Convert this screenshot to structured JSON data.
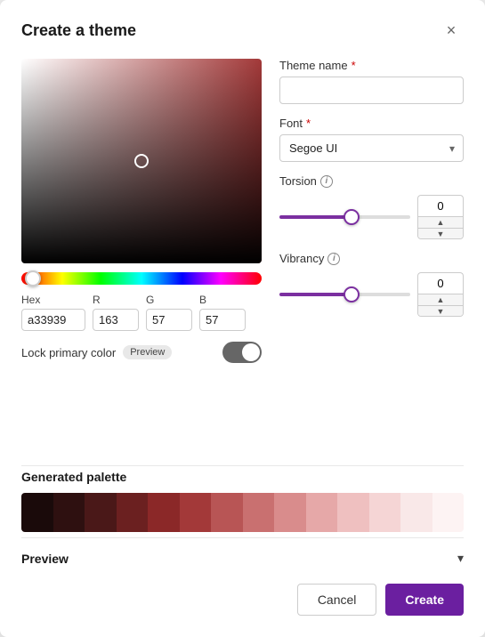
{
  "dialog": {
    "title": "Create a theme",
    "close_label": "×"
  },
  "color_picker": {
    "hex_label": "Hex",
    "r_label": "R",
    "g_label": "G",
    "b_label": "B",
    "hex_value": "a33939",
    "r_value": "163",
    "g_value": "57",
    "b_value": "57"
  },
  "lock_row": {
    "label": "Lock primary color",
    "preview_badge": "Preview"
  },
  "right_panel": {
    "theme_name_label": "Theme name",
    "required_star": "*",
    "theme_name_placeholder": "",
    "font_label": "Font",
    "font_required": "*",
    "font_value": "Segoe UI",
    "torsion_label": "Torsion",
    "torsion_value": "0",
    "vibrancy_label": "Vibrancy",
    "vibrancy_value": "0",
    "info_icon": "i"
  },
  "palette": {
    "title": "Generated palette",
    "swatches": [
      "#1a0a0a",
      "#2e1010",
      "#4a1818",
      "#6b2020",
      "#8b2828",
      "#a33939",
      "#b85555",
      "#c97070",
      "#d98c8c",
      "#e6a8a8",
      "#efc0c0",
      "#f5d5d5",
      "#f9e8e8",
      "#fdf3f3"
    ]
  },
  "preview_section": {
    "label": "Preview"
  },
  "footer": {
    "cancel_label": "Cancel",
    "create_label": "Create"
  }
}
